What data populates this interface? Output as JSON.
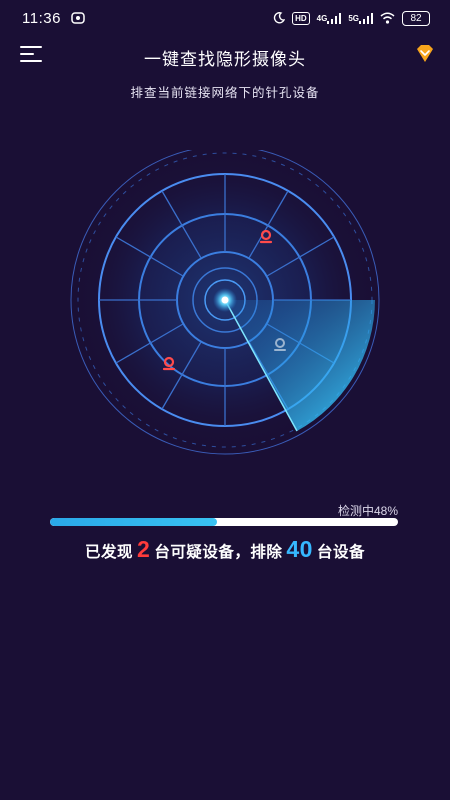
{
  "status_bar": {
    "time": "11:36",
    "network_1": "4G",
    "network_2": "5G",
    "hd": "HD",
    "battery": "82"
  },
  "header": {
    "title": "一键查找隐形摄像头",
    "subtitle": "排查当前链接网络下的针孔设备"
  },
  "scan": {
    "progress_label": "检测中48%",
    "progress_fraction": 0.48,
    "result_prefix": "已发现",
    "suspicious_count": "2",
    "result_middle": "台可疑设备，排除",
    "excluded_count": "40",
    "result_suffix": "台设备"
  },
  "colors": {
    "background": "#1a0f35",
    "accent_blue": "#36b8ff",
    "alert_red": "#ff3b3b"
  },
  "icons": {
    "menu": "menu-icon",
    "vip": "vip-diamond-icon",
    "device_marker": "location-pin-icon"
  }
}
